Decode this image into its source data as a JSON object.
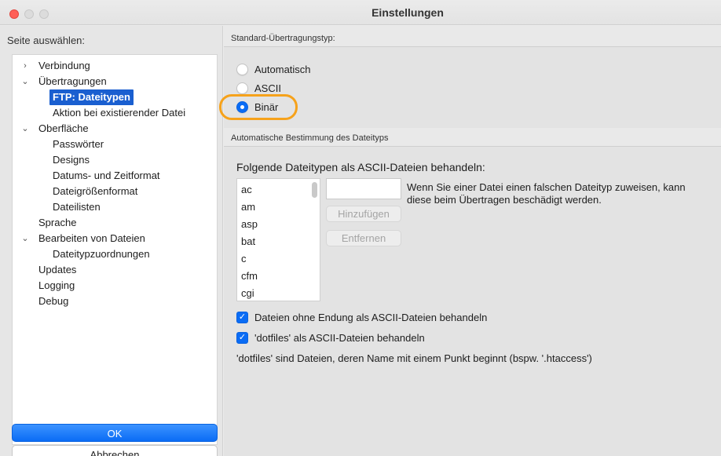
{
  "window": {
    "title": "Einstellungen"
  },
  "sidebar": {
    "header": "Seite auswählen:",
    "items": [
      {
        "label": "Verbindung",
        "arrow": "›"
      },
      {
        "label": "Übertragungen",
        "arrow": "⌄"
      },
      {
        "label": "FTP: Dateitypen",
        "selected": true
      },
      {
        "label": "Aktion bei existierender Datei"
      },
      {
        "label": "Oberfläche",
        "arrow": "⌄"
      },
      {
        "label": "Passwörter"
      },
      {
        "label": "Designs"
      },
      {
        "label": "Datums- und Zeitformat"
      },
      {
        "label": "Dateigrößenformat"
      },
      {
        "label": "Dateilisten"
      },
      {
        "label": "Sprache"
      },
      {
        "label": "Bearbeiten von Dateien",
        "arrow": "⌄"
      },
      {
        "label": "Dateitypzuordnungen"
      },
      {
        "label": "Updates"
      },
      {
        "label": "Logging"
      },
      {
        "label": "Debug"
      }
    ],
    "ok_label": "OK",
    "cancel_label": "Abbrechen"
  },
  "transfer_type": {
    "group_label": "Standard-Übertragungstyp:",
    "options": [
      {
        "label": "Automatisch",
        "checked": false
      },
      {
        "label": "ASCII",
        "checked": false
      },
      {
        "label": "Binär",
        "checked": true
      }
    ]
  },
  "auto_detect": {
    "group_label": "Automatische Bestimmung des Dateityps",
    "list_title": "Folgende Dateitypen als ASCII-Dateien behandeln:",
    "file_types": [
      "ac",
      "am",
      "asp",
      "bat",
      "c",
      "cfm",
      "cgi"
    ],
    "input_value": "",
    "add_label": "Hinzufügen",
    "remove_label": "Entfernen",
    "hint_line1": "Wenn Sie einer Datei einen falschen Dateityp zuweisen, kann",
    "hint_line2": "diese beim Übertragen beschädigt werden.",
    "check_no_ext": "Dateien ohne Endung als ASCII-Dateien behandeln",
    "check_dotfiles": "'dotfiles' als ASCII-Dateien behandeln",
    "dotfiles_note": "'dotfiles' sind Dateien, deren Name mit einem Punkt beginnt (bspw. '.htaccess')"
  },
  "colors": {
    "accent": "#0a6cf5",
    "highlight": "#f6a21b",
    "close": "#ff5f57"
  }
}
